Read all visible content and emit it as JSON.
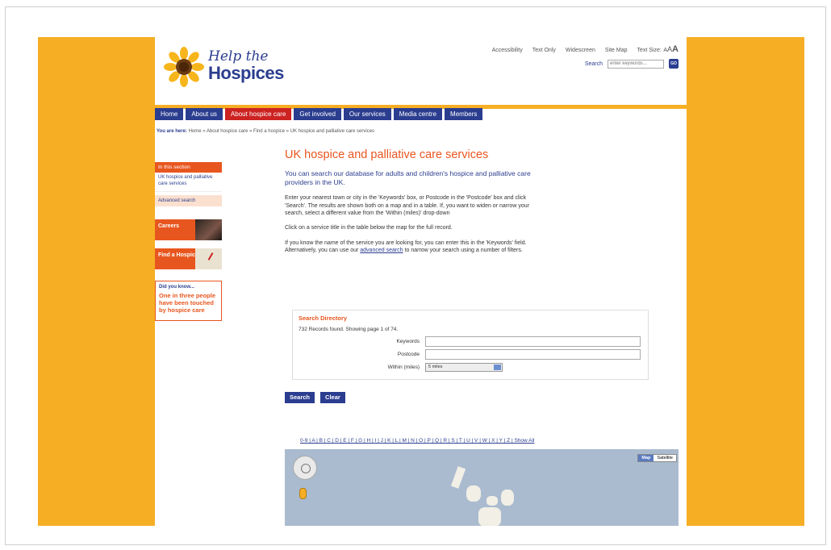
{
  "header": {
    "logo_top": "Help the",
    "logo_bottom": "Hospices",
    "util_links": [
      "Accessibility",
      "Text Only",
      "Widescreen",
      "Site Map"
    ],
    "text_size_label": "Text Size:",
    "text_size_small": "A",
    "text_size_medium": "A",
    "text_size_large": "A",
    "search_label": "Search",
    "search_placeholder": "enter keywords...",
    "search_button": "GO"
  },
  "nav": {
    "items": [
      "Home",
      "About us",
      "About hospice care",
      "Get involved",
      "Our services",
      "Media centre",
      "Members"
    ],
    "active_index": 2
  },
  "breadcrumb": {
    "label": "You are here:",
    "trail": "Home  »  About hospice care  »  Find a hospice  »  UK hospice and palliative care services"
  },
  "sidebar": {
    "section_title": "In this section",
    "items": [
      "UK hospice and palliative care services",
      "Advanced search"
    ],
    "promo_careers": "Careers",
    "promo_find": "Find a Hospice",
    "did_you_know_title": "Did you know...",
    "did_you_know_text": "One in three people have been touched by hospice care"
  },
  "main": {
    "title": "UK hospice and palliative care services",
    "intro": "You can search our database for adults and children's hospice and palliative care providers in the UK.",
    "para1": "Enter your nearest town or city in the 'Keywords' box, or Postcode in the 'Postcode' box and click 'Search'. The results are shown both on a map and in a table. If, you want to widen or narrow your search, select a different value from the 'Within (miles)' drop-down",
    "para2": "Click on a service title in the table below the map for the full record.",
    "para3_a": "If you know the name of the service you are looking for, you can enter this in the 'Keywords' field. Alternatively, you can use our",
    "para3_link": "advanced search",
    "para3_b": "to narrow your search using a number of filters."
  },
  "directory": {
    "title": "Search Directory",
    "found": "732 Records found. Showing page 1 of 74.",
    "keywords_label": "Keywords",
    "postcode_label": "Postcode",
    "within_label": "Within (miles)",
    "within_value": "5 miles",
    "search_button": "Search",
    "clear_button": "Clear"
  },
  "alphabet": "0-9 | A | B | C | D | E | F | G | H | I | J | K | L | M | N | O | P | Q | R | S | T | U | V | W | X | Y | Z | Show All",
  "map": {
    "type_map": "Map",
    "type_satellite": "Satellite"
  },
  "colors": {
    "brand_blue": "#2b3d8f",
    "brand_orange": "#e8561f",
    "page_orange": "#f6ae24",
    "nav_active": "#cc2222"
  }
}
